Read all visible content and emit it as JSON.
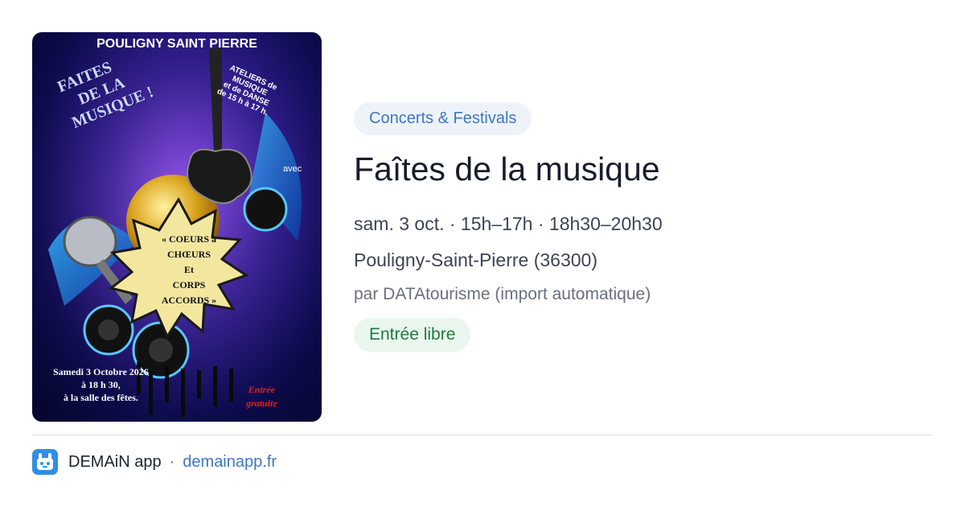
{
  "poster": {
    "top_title": "POULIGNY SAINT PIERRE",
    "left_heading_lines": [
      "FAITES",
      "DE LA",
      "MUSIQUE !"
    ],
    "workshops_lines": [
      "ATELIERS de",
      "MUSIQUE",
      "et de DANSE",
      "de 15 h à 17 h."
    ],
    "avec": "avec",
    "starburst_lines": [
      "« COEURS à",
      "CHŒURS",
      "Et",
      "CORPS",
      "ACCORDS »"
    ],
    "date_lines": [
      "Samedi 3 Octobre 2026",
      "à 18 h 30,",
      "à la salle des fêtes."
    ],
    "entry_lines": [
      "Entrée",
      "gratuite"
    ]
  },
  "event": {
    "category": "Concerts & Festivals",
    "title": "Faîtes de la musique",
    "schedule": "sam. 3 oct. · 15h–17h · 18h30–20h30",
    "location": "Pouligny-Saint-Pierre (36300)",
    "source": "par DATAtourisme (import automatique)",
    "price": "Entrée libre"
  },
  "footer": {
    "app_name": "DEMAiN app",
    "separator": "·",
    "domain": "demainapp.fr"
  },
  "colors": {
    "tag_bg": "#eef3fa",
    "tag_text": "#3f76c4",
    "free_bg": "#eaf6ee",
    "free_text": "#227a3d",
    "app_icon": "#2f8fe5"
  }
}
